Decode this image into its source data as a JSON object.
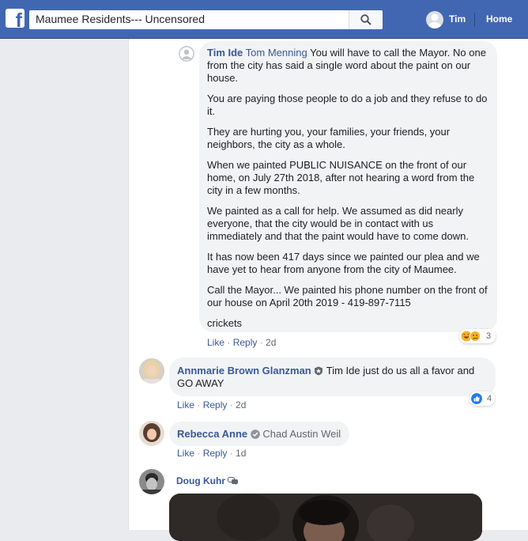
{
  "topbar": {
    "logo": "f",
    "search_value": "Maumee Residents--- Uncensored",
    "user_name": "Tim",
    "home_label": "Home"
  },
  "comments": [
    {
      "author": "Tim Ide",
      "mention": "Tom Menning",
      "paragraphs": [
        "You will have to call the Mayor. No one from the city has said a single word about the paint on our house.",
        "You are paying those people to do a job and they refuse to do it.",
        "They are hurting you, your families, your friends, your neighbors, the city as a whole.",
        "When we painted PUBLIC NUISANCE on the front of our home, on July 27th 2018, after not hearing a word from the city in a few months.",
        "We painted as a call for help. We assumed as did nearly everyone, that the city would be in contact with us immediately and that the paint would have to come down.",
        "It has now been 417 days since we painted our plea and we have yet to hear from anyone from the city of Maumee.",
        "Call the Mayor... We painted his phone number on the front of our house on April 20th 2019 - 419-897-7115",
        "crickets"
      ],
      "like": "Like",
      "reply": "Reply",
      "time": "2d",
      "reaction_count": "3",
      "reaction_icons": [
        "haha-icon",
        "sad-icon"
      ]
    },
    {
      "author": "Annmarie Brown Glanzman",
      "mention": "Tim Ide",
      "text": "just do us all a favor and GO AWAY",
      "like": "Like",
      "reply": "Reply",
      "time": "2d",
      "reaction_count": "4",
      "reaction_icons": [
        "like-icon"
      ]
    },
    {
      "author": "Rebecca Anne",
      "mention": "Chad Austin Weil",
      "like": "Like",
      "reply": "Reply",
      "time": "1d"
    },
    {
      "author": "Doug Kuhr"
    }
  ],
  "colors": {
    "brand": "#4267b2",
    "link": "#385898",
    "bubble": "#f2f3f5",
    "like_blue": "#2078f4"
  }
}
